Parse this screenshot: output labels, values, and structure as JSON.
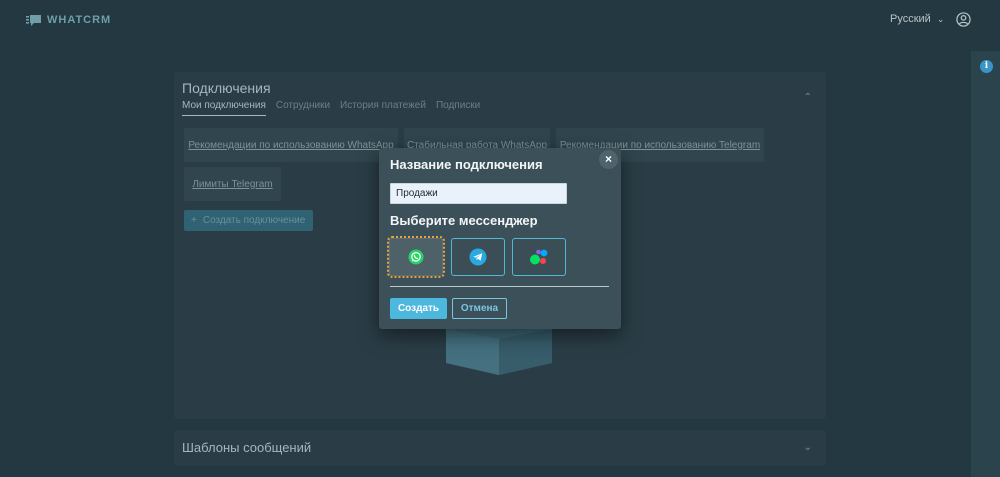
{
  "header": {
    "logo_text": "WHATCRM",
    "language": "Русский"
  },
  "card": {
    "title": "Подключения",
    "tabs": [
      {
        "label": "Мои подключения",
        "active": true
      },
      {
        "label": "Сотрудники",
        "active": false
      },
      {
        "label": "История платежей",
        "active": false
      },
      {
        "label": "Подписки",
        "active": false
      }
    ],
    "links": [
      "Рекомендации по использованию WhatsApp",
      "Стабильная работа WhatsApp",
      "Рекомендации по использованию Telegram",
      "Лимиты Telegram"
    ],
    "create_button": "Создать подключение"
  },
  "card2": {
    "title": "Шаблоны сообщений"
  },
  "modal": {
    "title": "Название подключения",
    "input_value": "Продажи",
    "subtitle": "Выберите мессенджер",
    "messengers": [
      {
        "icon": "whatsapp-icon",
        "selected": true
      },
      {
        "icon": "telegram-icon",
        "selected": false
      },
      {
        "icon": "avito-icon",
        "selected": false
      }
    ],
    "create_label": "Создать",
    "cancel_label": "Отмена",
    "close_glyph": "×"
  },
  "colors": {
    "background": "#243841",
    "accent": "#4db8dd",
    "whatsapp": "#25d366",
    "telegram": "#2aa8e0",
    "selection_outline": "#e9a53c"
  }
}
